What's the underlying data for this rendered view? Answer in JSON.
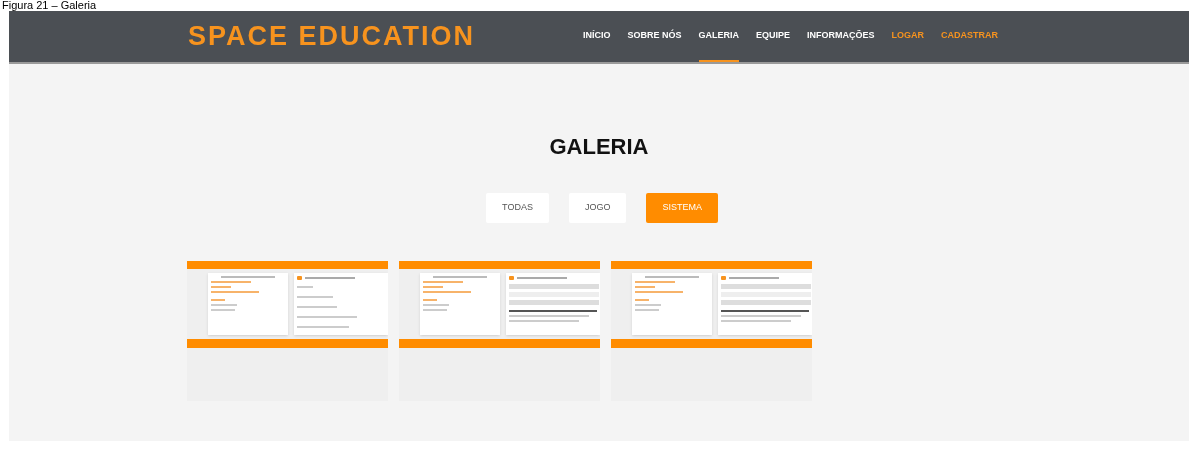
{
  "caption": "Figura 21 – Galeria",
  "header": {
    "logo": "SPACE EDUCATION",
    "nav": [
      {
        "label": "INÍCIO",
        "kind": "link",
        "selected": false
      },
      {
        "label": "SOBRE NÓS",
        "kind": "link",
        "selected": false
      },
      {
        "label": "GALERIA",
        "kind": "link",
        "selected": true
      },
      {
        "label": "EQUIPE",
        "kind": "link",
        "selected": false
      },
      {
        "label": "INFORMAÇÕES",
        "kind": "link",
        "selected": false
      },
      {
        "label": "LOGAR",
        "kind": "auth",
        "selected": false
      },
      {
        "label": "CADASTRAR",
        "kind": "auth",
        "selected": false
      }
    ]
  },
  "page_title": "GALERIA",
  "filters": [
    {
      "label": "TODAS",
      "selected": false
    },
    {
      "label": "JOGO",
      "selected": false
    },
    {
      "label": "SISTEMA",
      "selected": true
    }
  ],
  "gallery": [
    {
      "kind": "welcome"
    },
    {
      "kind": "form"
    },
    {
      "kind": "form"
    }
  ]
}
